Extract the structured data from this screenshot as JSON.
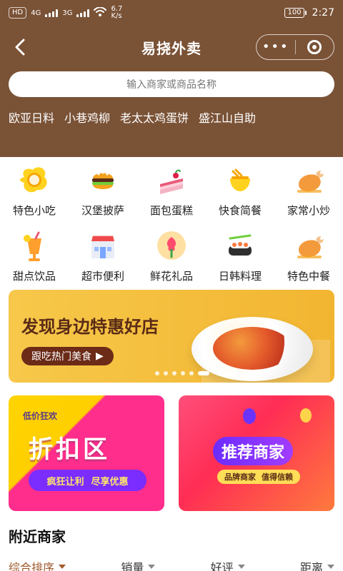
{
  "status_bar": {
    "hd_label": "HD",
    "network_4g_label": "4G",
    "network_3g_label": "3G",
    "speed_value": "6.7",
    "speed_unit": "K/s",
    "battery": "100",
    "time": "2:27"
  },
  "header": {
    "title": "易挠外卖"
  },
  "search": {
    "placeholder": "输入商家或商品名称"
  },
  "hot_keywords": [
    "欧亚日料",
    "小巷鸡柳",
    "老太太鸡蛋饼",
    "盛江山自助"
  ],
  "categories": [
    {
      "label": "特色小吃",
      "icon": "fried-egg-icon"
    },
    {
      "label": "汉堡披萨",
      "icon": "burger-icon"
    },
    {
      "label": "面包蛋糕",
      "icon": "cake-icon"
    },
    {
      "label": "快食简餐",
      "icon": "noodle-bowl-icon"
    },
    {
      "label": "家常小炒",
      "icon": "roast-chicken-icon"
    },
    {
      "label": "甜点饮品",
      "icon": "drink-icon"
    },
    {
      "label": "超市便利",
      "icon": "store-icon"
    },
    {
      "label": "鲜花礼品",
      "icon": "flower-icon"
    },
    {
      "label": "日韩料理",
      "icon": "sushi-icon"
    },
    {
      "label": "特色中餐",
      "icon": "chinese-food-icon"
    }
  ],
  "banner": {
    "headline": "发现身边特惠好店",
    "button_label": "跟吃热门美食",
    "pager_count": 6,
    "pager_active_index": 5
  },
  "promo_cards": {
    "discount": {
      "small_label": "低价狂欢",
      "title": "折扣区",
      "pill_left": "疯狂让利",
      "pill_right": "尽享优惠"
    },
    "recommend": {
      "title": "推荐商家",
      "sub_left": "品牌商家",
      "sub_right": "值得信赖"
    }
  },
  "nearby": {
    "title": "附近商家"
  },
  "sort_bar": [
    {
      "label": "综合排序",
      "active": true
    },
    {
      "label": "销量",
      "active": false
    },
    {
      "label": "好评",
      "active": false
    },
    {
      "label": "距离",
      "active": false
    }
  ],
  "colors": {
    "brand_brown": "#7a5236",
    "accent_brown": "#a05a2c"
  }
}
